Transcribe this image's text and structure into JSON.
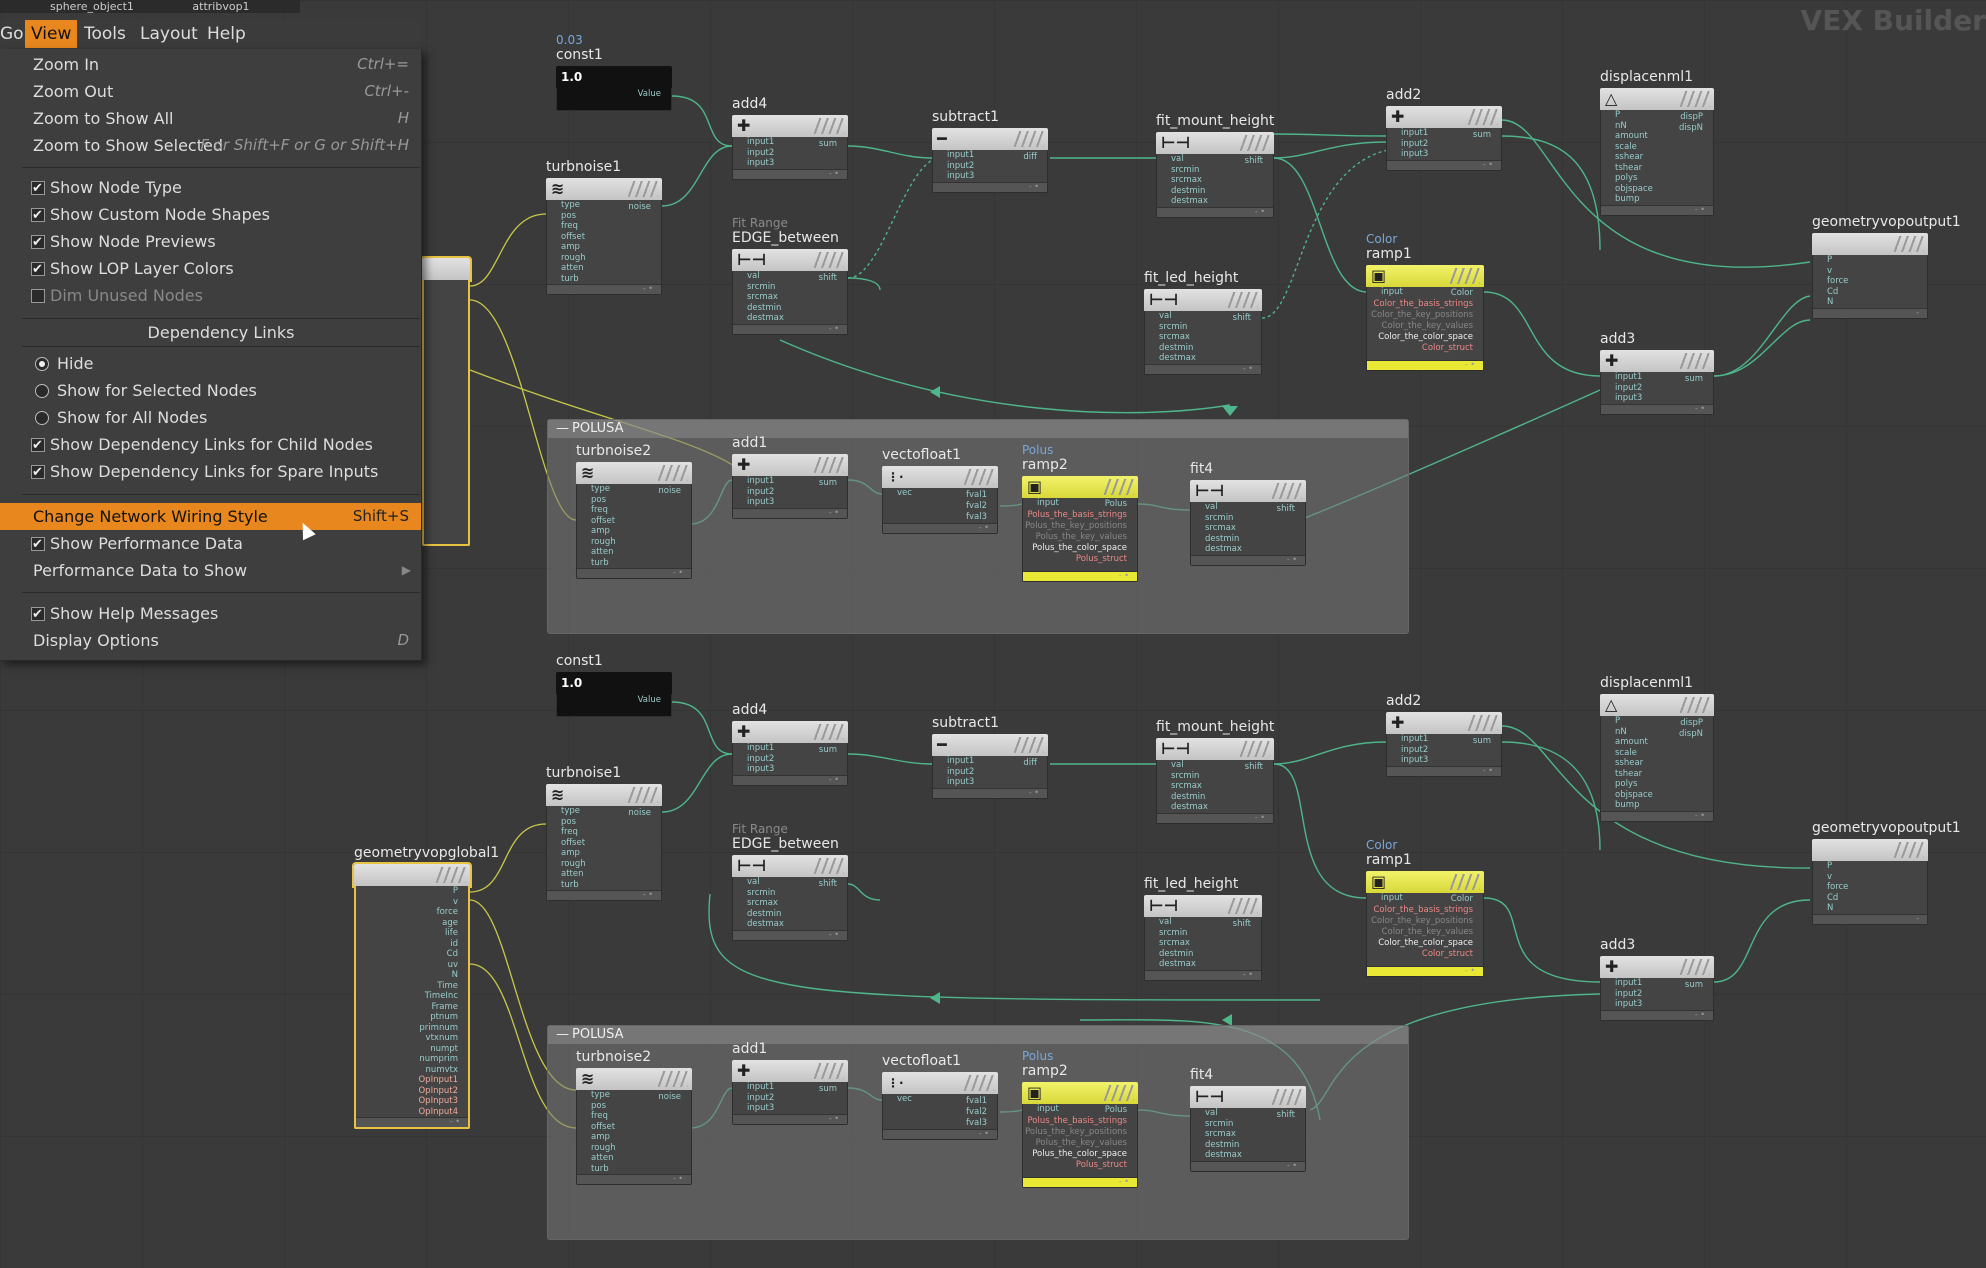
{
  "window": {
    "path_items": [
      "sphere_object1",
      "attribvop1"
    ],
    "context_title": "VEX Builder"
  },
  "menubar": {
    "items": [
      "Go",
      "View",
      "Tools",
      "Layout",
      "Help"
    ],
    "active": "View"
  },
  "view_menu": {
    "zoom_in": {
      "label": "Zoom In",
      "shortcut": "Ctrl+="
    },
    "zoom_out": {
      "label": "Zoom Out",
      "shortcut": "Ctrl+-"
    },
    "zoom_all": {
      "label": "Zoom to Show All",
      "shortcut": "H"
    },
    "zoom_selected": {
      "label": "Zoom to Show Selected",
      "shortcut": "F or Shift+F or G or Shift+H"
    },
    "show_node_type": {
      "label": "Show Node Type",
      "checked": true
    },
    "show_custom_shapes": {
      "label": "Show Custom Node Shapes",
      "checked": true
    },
    "show_node_previews": {
      "label": "Show Node Previews",
      "checked": true
    },
    "show_lop_colors": {
      "label": "Show LOP Layer Colors",
      "checked": true
    },
    "dim_unused": {
      "label": "Dim Unused Nodes",
      "checked": false
    },
    "dependency_header": "Dependency Links",
    "dep_hide": {
      "label": "Hide",
      "selected": true
    },
    "dep_selected": {
      "label": "Show for Selected Nodes",
      "selected": false
    },
    "dep_all": {
      "label": "Show for All Nodes",
      "selected": false
    },
    "dep_child": {
      "label": "Show Dependency Links for Child Nodes",
      "checked": true
    },
    "dep_spare": {
      "label": "Show Dependency Links for Spare Inputs",
      "checked": true
    },
    "wiring_style": {
      "label": "Change Network Wiring Style",
      "shortcut": "Shift+S"
    },
    "show_perf": {
      "label": "Show Performance Data",
      "checked": true
    },
    "perf_to_show": {
      "label": "Performance Data to Show"
    },
    "show_help": {
      "label": "Show Help Messages",
      "checked": true
    },
    "display_options": {
      "label": "Display Options",
      "shortcut": "D"
    }
  },
  "network": {
    "const1": {
      "name": "const1",
      "value_label": "0.03",
      "value": "1.0",
      "out": "Value"
    },
    "turbnoise1": {
      "name": "turbnoise1",
      "inputs": [
        "type",
        "pos",
        "freq",
        "offset",
        "amp",
        "rough",
        "atten",
        "turb"
      ],
      "out": "noise"
    },
    "add4": {
      "name": "add4",
      "inputs": [
        "input1",
        "input2",
        "input3"
      ],
      "out": "sum"
    },
    "subtract1": {
      "name": "subtract1",
      "inputs": [
        "input1",
        "input2",
        "input3"
      ],
      "out": "diff"
    },
    "fit_mount_height": {
      "name": "fit_mount_height",
      "inputs": [
        "val",
        "srcmin",
        "srcmax",
        "destmin",
        "destmax"
      ],
      "out": "shift"
    },
    "edge_between": {
      "name": "EDGE_between",
      "type_label": "Fit Range",
      "inputs": [
        "val",
        "srcmin",
        "srcmax",
        "destmin",
        "destmax"
      ],
      "out": "shift"
    },
    "fit_led_height": {
      "name": "fit_led_height",
      "inputs": [
        "val",
        "srcmin",
        "srcmax",
        "destmin",
        "destmax"
      ],
      "out": "shift"
    },
    "add2": {
      "name": "add2",
      "inputs": [
        "input1",
        "input2",
        "input3"
      ],
      "out": "sum"
    },
    "ramp1": {
      "name": "ramp1",
      "type_label": "Color",
      "inputs": [
        "input"
      ],
      "outs": [
        "Color",
        "Color_the_basis_strings",
        "Color_the_key_positions",
        "Color_the_key_values",
        "Color_the_color_space",
        "Color_struct"
      ]
    },
    "displacenml1": {
      "name": "displacenml1",
      "inputs": [
        "P",
        "nN",
        "amount",
        "scale",
        "sshear",
        "tshear",
        "polys",
        "objspace",
        "bump"
      ],
      "outs": [
        "dispP",
        "dispN"
      ]
    },
    "add3": {
      "name": "add3",
      "inputs": [
        "input1",
        "input2",
        "input3"
      ],
      "out": "sum"
    },
    "geometryvopoutput1": {
      "name": "geometryvopoutput1",
      "inputs": [
        "P",
        "v",
        "force",
        "Cd",
        "N"
      ]
    },
    "geometryvopglobal1": {
      "name": "geometryvopglobal1",
      "outs": [
        "P",
        "v",
        "force",
        "age",
        "life",
        "id",
        "Cd",
        "uv",
        "N",
        "Time",
        "TimeInc",
        "Frame",
        "ptnum",
        "primnum",
        "vtxnum",
        "numpt",
        "numprim",
        "numvtx",
        "OpInput1",
        "OpInput2",
        "OpInput3",
        "OpInput4"
      ]
    },
    "polusa": {
      "name": "POLUSA"
    },
    "add1": {
      "name": "add1",
      "inputs": [
        "input1",
        "input2",
        "input3"
      ],
      "out": "sum"
    },
    "turbnoise2": {
      "name": "turbnoise2",
      "inputs": [
        "type",
        "pos",
        "freq",
        "offset",
        "amp",
        "rough",
        "atten",
        "turb"
      ],
      "out": "noise"
    },
    "vectofloat1": {
      "name": "vectofloat1",
      "inputs": [
        "vec"
      ],
      "outs": [
        "fval1",
        "fval2",
        "fval3"
      ]
    },
    "ramp2": {
      "name": "ramp2",
      "type_label": "Polus",
      "inputs": [
        "input"
      ],
      "outs": [
        "Polus",
        "Polus_the_basis_strings",
        "Polus_the_key_positions",
        "Polus_the_key_values",
        "Polus_the_color_space",
        "Polus_struct"
      ]
    },
    "fit4": {
      "name": "fit4",
      "inputs": [
        "val",
        "srcmin",
        "srcmax",
        "destmin",
        "destmax"
      ],
      "out": "shift"
    }
  },
  "colors": {
    "accent": "#e8871e",
    "wire": "#4fb58a",
    "wire_global": "#c8c84a",
    "node_yellow": "#e9e935"
  }
}
